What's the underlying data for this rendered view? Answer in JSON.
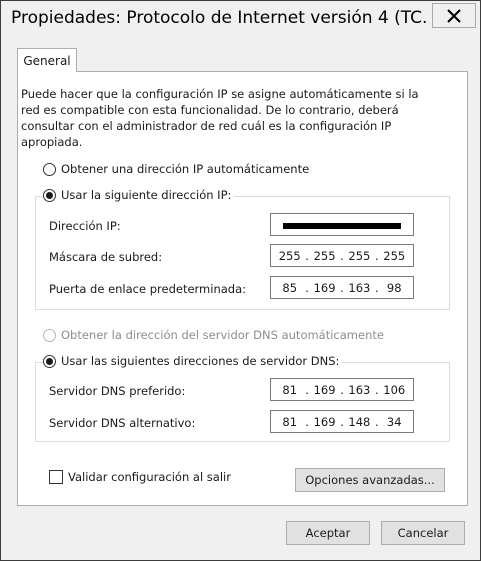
{
  "window": {
    "title": "Propiedades: Protocolo de Internet versión 4 (TC..."
  },
  "tabs": [
    {
      "label": "General"
    }
  ],
  "description": "Puede hacer que la configuración IP se asigne automáticamente si la red es compatible con esta funcionalidad. De lo contrario, deberá consultar con el administrador de red cuál es la configuración IP apropiada.",
  "ip_section": {
    "auto_label": "Obtener una dirección IP automáticamente",
    "manual_label": "Usar la siguiente dirección IP:",
    "selected": "manual",
    "fields": [
      {
        "label": "Dirección IP:",
        "octets": [
          "",
          "",
          "",
          ""
        ],
        "redacted": true
      },
      {
        "label": "Máscara de subred:",
        "octets": [
          "255",
          "255",
          "255",
          "255"
        ]
      },
      {
        "label": "Puerta de enlace predeterminada:",
        "octets": [
          "85",
          "169",
          "163",
          "98"
        ]
      }
    ]
  },
  "dns_section": {
    "auto_label": "Obtener la dirección del servidor DNS automáticamente",
    "manual_label": "Usar las siguientes direcciones de servidor DNS:",
    "selected": "manual",
    "fields": [
      {
        "label": "Servidor DNS preferido:",
        "octets": [
          "81",
          "169",
          "163",
          "106"
        ]
      },
      {
        "label": "Servidor DNS alternativo:",
        "octets": [
          "81",
          "169",
          "148",
          "34"
        ]
      }
    ]
  },
  "validate_checkbox": {
    "label": "Validar configuración al salir",
    "checked": false
  },
  "buttons": {
    "advanced": "Opciones avanzadas...",
    "accept": "Aceptar",
    "cancel": "Cancelar"
  },
  "icons": {
    "close": "close-icon"
  }
}
